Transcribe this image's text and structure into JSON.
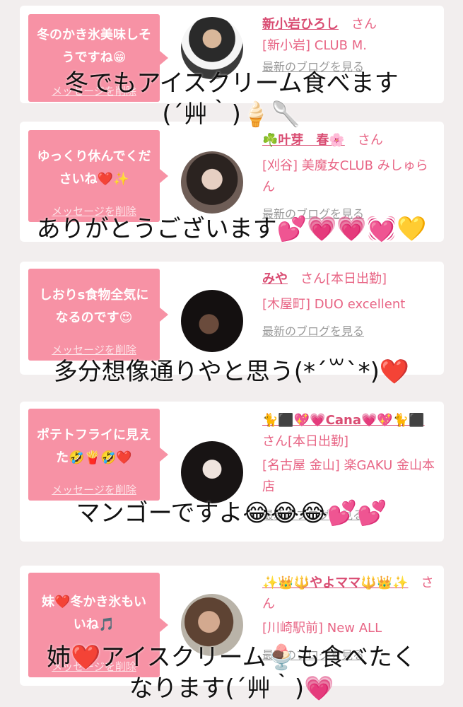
{
  "cards": [
    {
      "message": "冬のかき氷美味しそうですね😁",
      "delete_label": "メッセージを削除",
      "name": "新小岩ひろし",
      "honorific": "さん",
      "shop": "[新小岩] CLUB M.",
      "blog_link": "最新のブログを見る"
    },
    {
      "message": "ゆっくり休んでくださいね❤️✨",
      "delete_label": "メッセージを削除",
      "name": "☘️叶芽　春🌸",
      "honorific": "さん",
      "shop": "[刈谷] 美魔女CLUB みしゅらん",
      "blog_link": "最新のブログを見る"
    },
    {
      "message": "しおりs食物全気になるのです😍",
      "delete_label": "メッセージを削除",
      "name": "みや",
      "honorific": "さん[本日出勤]",
      "shop": "[木屋町] DUO excellent",
      "blog_link": "最新のブログを見る"
    },
    {
      "message": "ポテトフライに見えた🤣🍟🤣❤️",
      "delete_label": "メッセージを削除",
      "name": "🐈⬛💖💗Cana💗💖🐈⬛",
      "honorific": "さん[本日出勤]",
      "shop": "[名古屋 金山] 楽GAKU 金山本店",
      "blog_link": "最新のブログを見る"
    },
    {
      "message": "妹❤️冬かき氷もいいね🎵",
      "delete_label": "メッセージを削除",
      "name": "✨👑🔱やよママ🔱👑✨",
      "honorific": "さん",
      "shop": "[川崎駅前] New ALL",
      "blog_link": "最新のブログを見る"
    }
  ],
  "captions": [
    {
      "line1": "冬でもアイスクリーム食べます",
      "line2": "(´艸｀)🍦🥄"
    },
    {
      "line1": "ありがとうございます💕💗💗💓💛",
      "line2": ""
    },
    {
      "line1": "多分想像通りやと思う(*ˊ꒳ˋ*)❤️",
      "line2": ""
    },
    {
      "line1": "マンゴーですよ😂😂😂💕💕",
      "line2": ""
    },
    {
      "line1": "姉❤️アイスクリーム🍨も食べたく",
      "line2": "なります(´艸｀)💗"
    }
  ],
  "colors": {
    "bubble": "#f792a5",
    "name": "#d94c72",
    "shop": "#e86585",
    "background": "#f2eeee"
  }
}
